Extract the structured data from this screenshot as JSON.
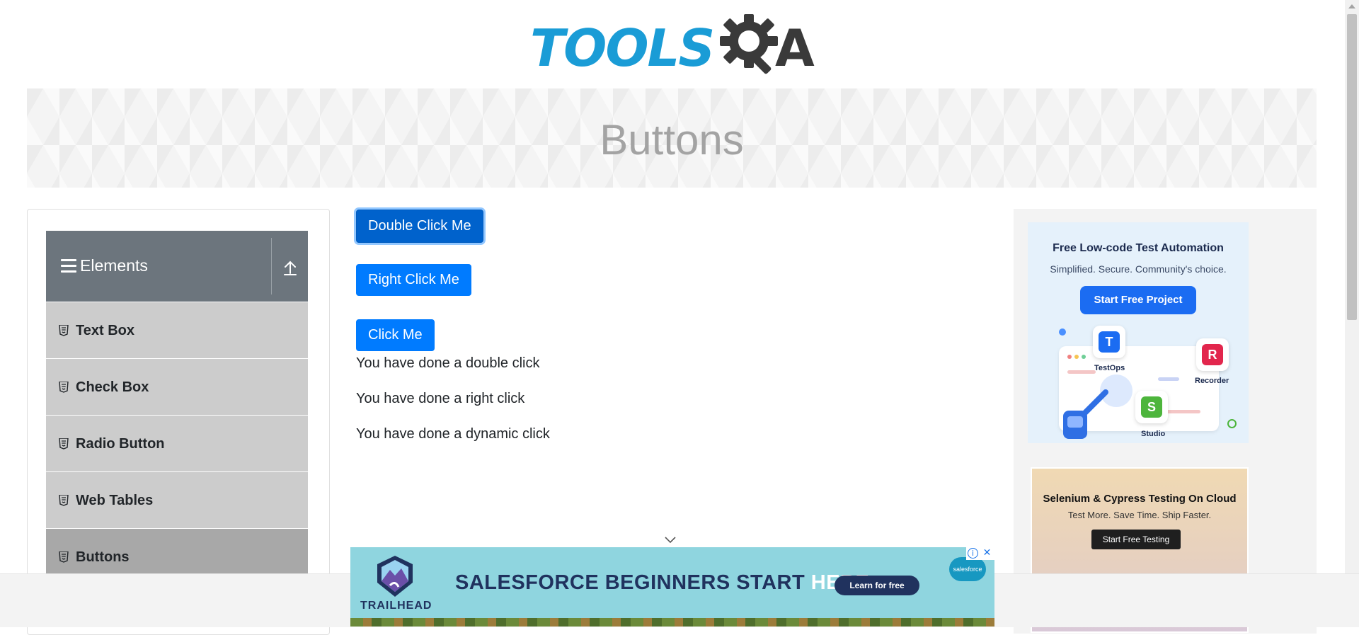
{
  "logo": {
    "text": "TOOLS",
    "suffix": "A"
  },
  "page": {
    "title": "Buttons"
  },
  "sidebar": {
    "group": {
      "title": "Elements"
    },
    "items": [
      {
        "label": "Text Box"
      },
      {
        "label": "Check Box"
      },
      {
        "label": "Radio Button"
      },
      {
        "label": "Web Tables"
      },
      {
        "label": "Buttons"
      }
    ],
    "active_item": "Buttons"
  },
  "buttons": {
    "double_click": "Double Click Me",
    "right_click": "Right Click Me",
    "dynamic_click": "Click Me"
  },
  "messages": {
    "double": "You have done a double click",
    "right": "You have done a right click",
    "dynamic": "You have done a dynamic click"
  },
  "ads": {
    "katalon": {
      "title": "Free Low-code Test Automation",
      "subtitle": "Simplified. Secure. Community's choice.",
      "cta": "Start Free Project",
      "tiles": [
        {
          "letter": "T",
          "label": "TestOps",
          "color": "#1b6cf2"
        },
        {
          "letter": "R",
          "label": "Recorder",
          "color": "#e2264d"
        },
        {
          "letter": "S",
          "label": "Studio",
          "color": "#4db53c"
        }
      ]
    },
    "lambdatest": {
      "title": "Selenium & Cypress Testing On Cloud",
      "subtitle": "Test More. Save Time. Ship Faster.",
      "cta": "Start Free Testing"
    },
    "salesforce": {
      "headline_main": "SALESFORCE BEGINNERS START ",
      "headline_highlight": "HERE.",
      "cta": "Learn for free",
      "brand": "TRAILHEAD",
      "logo_text": "salesforce"
    }
  },
  "colors": {
    "primary": "#007bff",
    "sidebar_header": "#6c757d",
    "menu_item": "#cccccc",
    "menu_item_active": "#a8a8a8",
    "logo_blue": "#1a9cd6"
  }
}
